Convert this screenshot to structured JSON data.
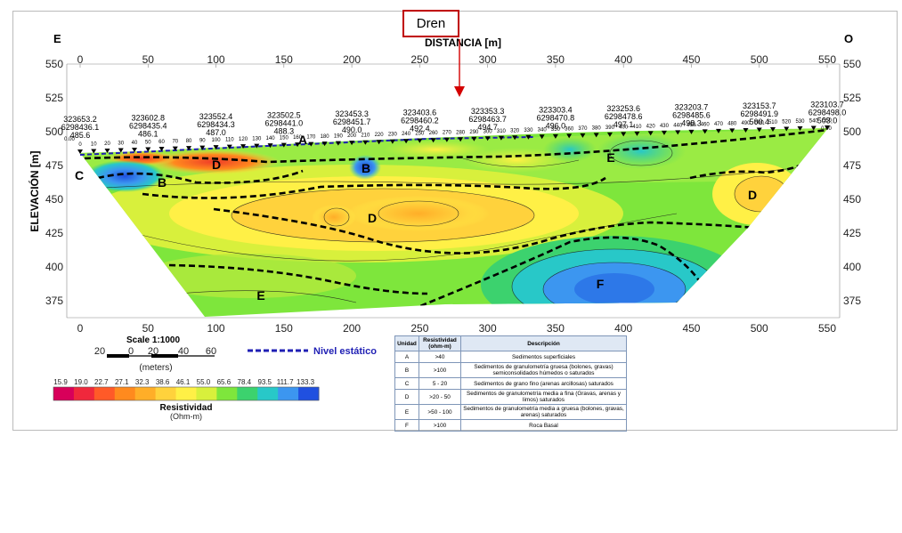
{
  "dren_label": "Dren",
  "axis": {
    "title": "DISTANCIA [m]",
    "ylabel": "ELEVACIÓN [m]",
    "left_dir": "E",
    "right_dir": "O",
    "x_ticks": [
      "0",
      "50",
      "100",
      "150",
      "200",
      "250",
      "300",
      "350",
      "400",
      "450",
      "500",
      "550"
    ],
    "y_ticks": [
      "550",
      "525",
      "500",
      "475",
      "450",
      "425",
      "400",
      "375"
    ]
  },
  "stations": [
    {
      "x": "323653.2",
      "y": "6298436.1",
      "z": "485.6"
    },
    {
      "x": "323602.8",
      "y": "6298435.4",
      "z": "486.1"
    },
    {
      "x": "323552.4",
      "y": "6298434.3",
      "z": "487.0"
    },
    {
      "x": "323502.5",
      "y": "6298441.0",
      "z": "488.3"
    },
    {
      "x": "323453.3",
      "y": "6298451.7",
      "z": "490.0"
    },
    {
      "x": "323403.6",
      "y": "6298460.2",
      "z": "492.4"
    },
    {
      "x": "323353.3",
      "y": "6298463.7",
      "z": "494.7"
    },
    {
      "x": "323303.4",
      "y": "6298470.8",
      "z": "496.0"
    },
    {
      "x": "323253.6",
      "y": "6298478.6",
      "z": "497.1"
    },
    {
      "x": "323203.7",
      "y": "6298485.6",
      "z": "498.3"
    },
    {
      "x": "323153.7",
      "y": "6298491.9",
      "z": "500.4"
    },
    {
      "x": "323103.7",
      "y": "6298498.0",
      "z": "503.0"
    }
  ],
  "electrode_labels": [
    "0",
    "10",
    "20",
    "30",
    "40",
    "50",
    "60",
    "70",
    "80",
    "90",
    "100",
    "110",
    "120",
    "130",
    "140",
    "150",
    "160",
    "170",
    "180",
    "190",
    "200",
    "210",
    "220",
    "230",
    "240",
    "250",
    "260",
    "270",
    "280",
    "290",
    "300",
    "310",
    "320",
    "330",
    "340",
    "350",
    "360",
    "370",
    "380",
    "390",
    "400",
    "410",
    "420",
    "430",
    "440",
    "450",
    "460",
    "470",
    "480",
    "490",
    "500",
    "510",
    "520",
    "530",
    "540",
    "550"
  ],
  "zones": {
    "A": "A",
    "B": "B",
    "C": "C",
    "D": "D",
    "E": "E",
    "F": "F"
  },
  "scale": {
    "title": "Scale 1:1000",
    "ticks": [
      "20",
      "0",
      "20",
      "40",
      "60"
    ],
    "unit": "(meters)"
  },
  "legend": {
    "line_label": "Nivel estático",
    "colorbar_values": [
      "15.9",
      "19.0",
      "22.7",
      "27.1",
      "32.3",
      "38.6",
      "46.1",
      "55.0",
      "65.6",
      "78.4",
      "93.5",
      "111.7",
      "133.3"
    ],
    "colorbar_colors": [
      "#d8005a",
      "#f0283c",
      "#ff5a28",
      "#ff8a1e",
      "#ffae28",
      "#ffd23c",
      "#fff046",
      "#d8f03c",
      "#7ee63c",
      "#3cd26e",
      "#28c8c8",
      "#3c96f0",
      "#2050e0"
    ],
    "colorbar_title": "Resistividad",
    "colorbar_unit": "(Ohm-m)"
  },
  "table": {
    "headers": [
      "Unidad",
      "Resistividad (ohm-m)",
      "Descripción"
    ],
    "rows": [
      {
        "unit": "A",
        "res": ">40",
        "desc": "Sedimentos superficiales"
      },
      {
        "unit": "B",
        "res": ">100",
        "desc": "Sedimentos de granulometría gruesa (bolones, gravas) semiconsolidados húmedos o saturados"
      },
      {
        "unit": "C",
        "res": "5 - 20",
        "desc": "Sedimentos de grano fino (arenas arcillosas) saturados"
      },
      {
        "unit": "D",
        "res": ">20 - 50",
        "desc": "Sedimentos de granulometría media a fina (Gravas, arenas y limos) saturados"
      },
      {
        "unit": "E",
        "res": ">50 - 100",
        "desc": "Sedimentos de granulometría media a gruesa (bolones, gravas, arenas) saturados"
      },
      {
        "unit": "F",
        "res": ">100",
        "desc": "Roca Basal"
      }
    ]
  }
}
